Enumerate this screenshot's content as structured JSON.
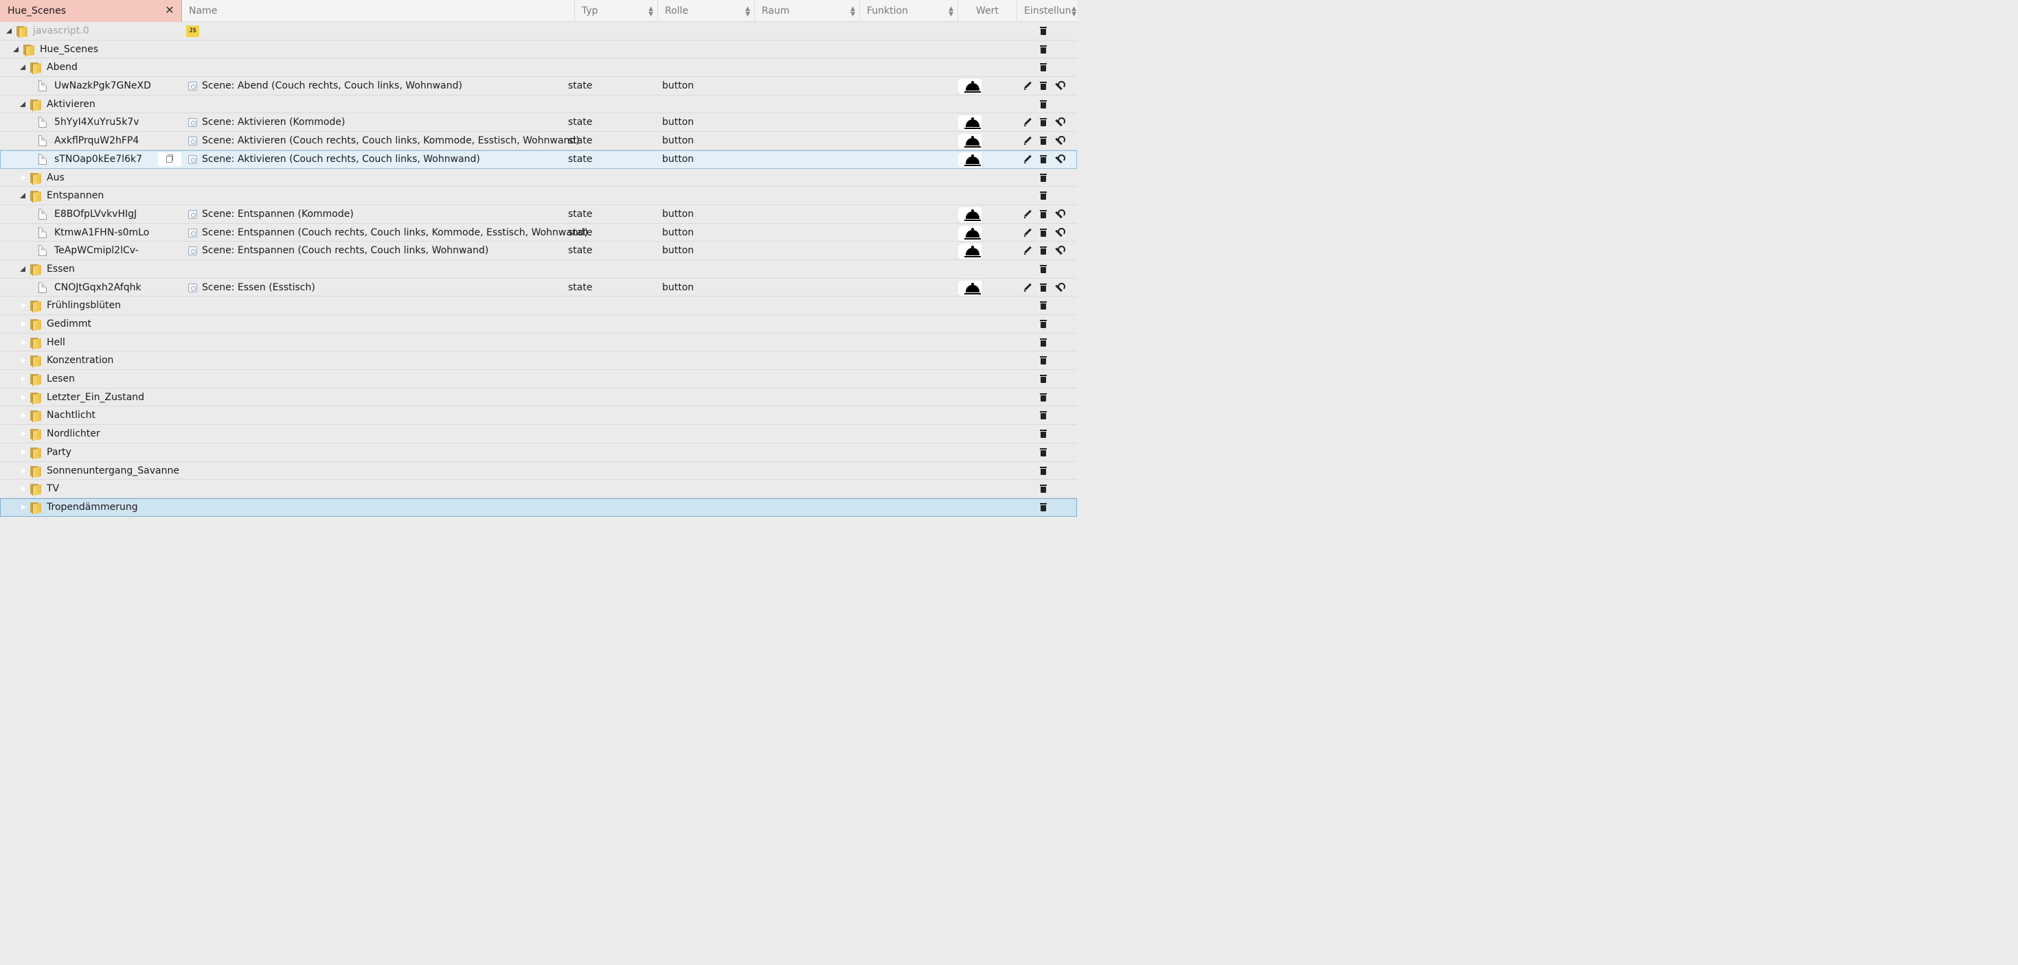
{
  "filter": {
    "value": "Hue_Scenes",
    "clear_icon": "close-icon"
  },
  "columns": {
    "name": "Name",
    "typ": "Typ",
    "rolle": "Rolle",
    "raum": "Raum",
    "funktion": "Funktion",
    "wert": "Wert",
    "einstellungen": "Einstellun"
  },
  "rows": [
    {
      "label": "javascript.0",
      "kind": "adapter",
      "level": 0,
      "toggle": "open",
      "muted": true,
      "name": "",
      "typ": "",
      "rolle": "",
      "badge": "JS"
    },
    {
      "label": "Hue_Scenes",
      "kind": "folder",
      "level": 1,
      "toggle": "open",
      "name": "",
      "typ": "",
      "rolle": ""
    },
    {
      "label": "Abend",
      "kind": "folder",
      "level": 2,
      "toggle": "open",
      "name": "",
      "typ": "",
      "rolle": ""
    },
    {
      "label": "UwNazkPgk7GNeXD",
      "kind": "state",
      "level": 3,
      "name": "Scene: Abend (Couch rechts, Couch links, Wohnwand)",
      "typ": "state",
      "rolle": "button"
    },
    {
      "label": "Aktivieren",
      "kind": "folder",
      "level": 2,
      "toggle": "open",
      "name": "",
      "typ": "",
      "rolle": ""
    },
    {
      "label": "5hYyI4XuYru5k7v",
      "kind": "state",
      "level": 3,
      "name": "Scene: Aktivieren (Kommode)",
      "typ": "state",
      "rolle": "button"
    },
    {
      "label": "AxkflPrquW2hFP4",
      "kind": "state",
      "level": 3,
      "name": "Scene: Aktivieren (Couch rechts, Couch links, Kommode, Esstisch, Wohnwand)",
      "typ": "state",
      "rolle": "button"
    },
    {
      "label": "sTNOap0kEe7l6k7",
      "kind": "state",
      "level": 3,
      "selected": "light",
      "copy": true,
      "name": "Scene: Aktivieren (Couch rechts, Couch links, Wohnwand)",
      "typ": "state",
      "rolle": "button"
    },
    {
      "label": "Aus",
      "kind": "folder",
      "level": 2,
      "toggle": "closed",
      "name": "",
      "typ": "",
      "rolle": ""
    },
    {
      "label": "Entspannen",
      "kind": "folder",
      "level": 2,
      "toggle": "open",
      "name": "",
      "typ": "",
      "rolle": ""
    },
    {
      "label": "E8BOfpLVvkvHIgJ",
      "kind": "state",
      "level": 3,
      "name": "Scene: Entspannen (Kommode)",
      "typ": "state",
      "rolle": "button"
    },
    {
      "label": "KtmwA1FHN-s0mLo",
      "kind": "state",
      "level": 3,
      "name": "Scene: Entspannen (Couch rechts, Couch links, Kommode, Esstisch, Wohnwand)",
      "typ": "state",
      "rolle": "button"
    },
    {
      "label": "TeApWCmipl2lCv-",
      "kind": "state",
      "level": 3,
      "name": "Scene: Entspannen (Couch rechts, Couch links, Wohnwand)",
      "typ": "state",
      "rolle": "button"
    },
    {
      "label": "Essen",
      "kind": "folder",
      "level": 2,
      "toggle": "open",
      "name": "",
      "typ": "",
      "rolle": ""
    },
    {
      "label": "CNOJtGqxh2Afqhk",
      "kind": "state",
      "level": 3,
      "name": "Scene: Essen (Esstisch)",
      "typ": "state",
      "rolle": "button"
    },
    {
      "label": "Frühlingsblüten",
      "kind": "folder",
      "level": 2,
      "toggle": "closed",
      "name": "",
      "typ": "",
      "rolle": ""
    },
    {
      "label": "Gedimmt",
      "kind": "folder",
      "level": 2,
      "toggle": "closed",
      "name": "",
      "typ": "",
      "rolle": ""
    },
    {
      "label": "Hell",
      "kind": "folder",
      "level": 2,
      "toggle": "closed",
      "name": "",
      "typ": "",
      "rolle": ""
    },
    {
      "label": "Konzentration",
      "kind": "folder",
      "level": 2,
      "toggle": "closed",
      "name": "",
      "typ": "",
      "rolle": ""
    },
    {
      "label": "Lesen",
      "kind": "folder",
      "level": 2,
      "toggle": "closed",
      "name": "",
      "typ": "",
      "rolle": ""
    },
    {
      "label": "Letzter_Ein_Zustand",
      "kind": "folder",
      "level": 2,
      "toggle": "closed",
      "name": "",
      "typ": "",
      "rolle": ""
    },
    {
      "label": "Nachtlicht",
      "kind": "folder",
      "level": 2,
      "toggle": "closed",
      "name": "",
      "typ": "",
      "rolle": ""
    },
    {
      "label": "Nordlichter",
      "kind": "folder",
      "level": 2,
      "toggle": "closed",
      "name": "",
      "typ": "",
      "rolle": ""
    },
    {
      "label": "Party",
      "kind": "folder",
      "level": 2,
      "toggle": "closed",
      "name": "",
      "typ": "",
      "rolle": ""
    },
    {
      "label": "Sonnenuntergang_Savanne",
      "kind": "folder",
      "level": 2,
      "toggle": "closed",
      "name": "",
      "typ": "",
      "rolle": ""
    },
    {
      "label": "TV",
      "kind": "folder",
      "level": 2,
      "toggle": "closed",
      "name": "",
      "typ": "",
      "rolle": ""
    },
    {
      "label": "Tropendämmerung",
      "kind": "folder",
      "level": 2,
      "toggle": "closed",
      "selected": "strong",
      "name": "",
      "typ": "",
      "rolle": ""
    }
  ],
  "icons": {
    "folder": "folder-icon",
    "state": "file-icon",
    "value_button": "bell-icon",
    "edit": "pencil-icon",
    "delete": "trash-icon",
    "settings": "wrench-icon",
    "copy": "copy-icon",
    "state_type": "state-type-icon"
  },
  "colors": {
    "filter_active_bg": "#f6c7be",
    "selection_bg": "#e3f0f8",
    "selection_strong_bg": "#cfe4f1",
    "js_badge": "#f0d44c"
  }
}
